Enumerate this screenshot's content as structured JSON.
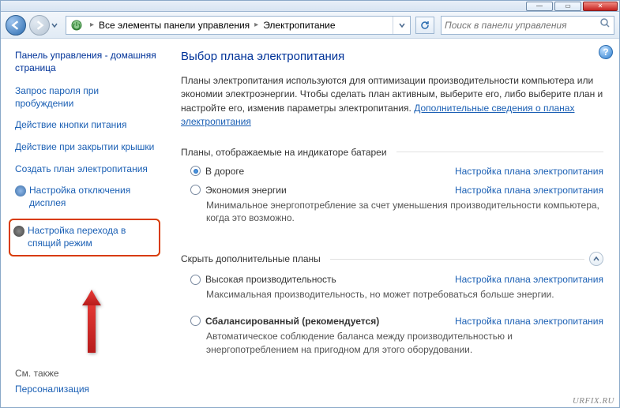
{
  "windowButtons": {
    "min": "—",
    "max": "▭",
    "close": "✕"
  },
  "breadcrumb": {
    "item1": "Все элементы панели управления",
    "item2": "Электропитание"
  },
  "search": {
    "placeholder": "Поиск в панели управления"
  },
  "sidebar": {
    "home": "Панель управления - домашняя страница",
    "items": [
      "Запрос пароля при пробуждении",
      "Действие кнопки питания",
      "Действие при закрытии крышки",
      "Создать план электропитания",
      "Настройка отключения дисплея",
      "Настройка перехода в спящий режим"
    ],
    "seeAlsoLabel": "См. также",
    "seeAlso": [
      "Персонализация"
    ]
  },
  "main": {
    "title": "Выбор плана электропитания",
    "description": "Планы электропитания используются для оптимизации производительности компьютера или экономии электроэнергии. Чтобы сделать план активным, выберите его, либо выберите план и настройте его, изменив параметры электропитания. ",
    "learnMore": "Дополнительные сведения о планах электропитания",
    "sectionShown": "Планы, отображаемые на индикаторе батареи",
    "sectionHidden": "Скрыть дополнительные планы",
    "planLink": "Настройка плана электропитания",
    "plans": {
      "shown": [
        {
          "name": "В дороге",
          "checked": true,
          "desc": ""
        },
        {
          "name": "Экономия энергии",
          "checked": false,
          "desc": "Минимальное энергопотребление за счет уменьшения производительности компьютера, когда это возможно."
        }
      ],
      "hidden": [
        {
          "name": "Высокая производительность",
          "checked": false,
          "desc": "Максимальная производительность, но может потребоваться больше энергии."
        },
        {
          "name": "Сбалансированный (рекомендуется)",
          "checked": false,
          "bold": true,
          "desc": "Автоматическое соблюдение баланса между производительностью и энергопотреблением на пригодном для этого оборудовании."
        }
      ]
    }
  },
  "watermark": "URFIX.RU"
}
